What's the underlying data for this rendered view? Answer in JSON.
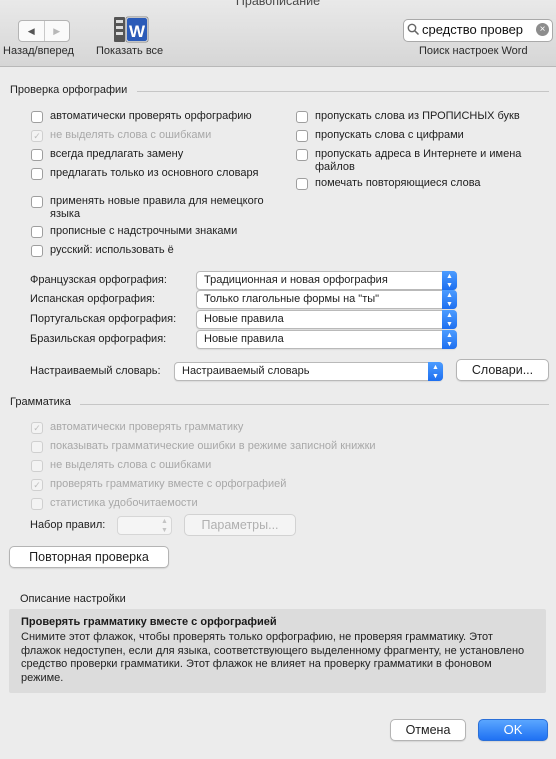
{
  "window": {
    "title": "Правописание"
  },
  "toolbar": {
    "nav_label": "Назад/вперед",
    "show_all_label": "Показать все",
    "search": {
      "value": "средство провер",
      "label": "Поиск настроек Word"
    }
  },
  "spelling": {
    "title": "Проверка орфографии",
    "left_options": [
      {
        "label": "автоматически проверять орфографию",
        "checked": false,
        "disabled": false
      },
      {
        "label": "не выделять слова с ошибками",
        "checked": true,
        "disabled": true
      },
      {
        "label": "всегда предлагать замену",
        "checked": false,
        "disabled": false
      },
      {
        "label": "предлагать только из основного словаря",
        "checked": false,
        "disabled": false
      },
      {
        "label": "применять новые правила для немецкого языка",
        "checked": false,
        "disabled": false
      },
      {
        "label": "прописные с надстрочными знаками",
        "checked": false,
        "disabled": false
      },
      {
        "label": "русский: использовать ё",
        "checked": false,
        "disabled": false
      }
    ],
    "right_options": [
      {
        "label": "пропускать слова из ПРОПИСНЫХ букв",
        "checked": false
      },
      {
        "label": "пропускать слова с цифрами",
        "checked": false
      },
      {
        "label": "пропускать адреса в Интернете и имена файлов",
        "checked": false
      },
      {
        "label": "помечать повторяющиеся слова",
        "checked": false
      }
    ],
    "language_modes": [
      {
        "label": "Французская орфография:",
        "value": "Традиционная и новая орфография"
      },
      {
        "label": "Испанская орфография:",
        "value": "Только глагольные формы на \"ты\""
      },
      {
        "label": "Португальская орфография:",
        "value": "Новые правила"
      },
      {
        "label": "Бразильская орфография:",
        "value": "Новые правила"
      }
    ],
    "custom_dictionary": {
      "label": "Настраиваемый словарь:",
      "value": "Настраиваемый словарь",
      "button": "Словари..."
    }
  },
  "grammar": {
    "title": "Грамматика",
    "options": [
      {
        "label": "автоматически проверять грамматику",
        "checked": true,
        "disabled": true
      },
      {
        "label": "показывать грамматические ошибки в режиме записной книжки",
        "checked": false,
        "disabled": true
      },
      {
        "label": "не выделять слова с ошибками",
        "checked": false,
        "disabled": true
      },
      {
        "label": "проверять грамматику вместе с орфографией",
        "checked": true,
        "disabled": true
      },
      {
        "label": "статистика удобочитаемости",
        "checked": false,
        "disabled": true
      }
    ],
    "rules_label": "Набор правил:",
    "params_button": "Параметры..."
  },
  "recheck_button": "Повторная проверка",
  "description": {
    "title": "Описание настройки",
    "heading": "Проверять грамматику вместе с орфографией",
    "text": "Снимите этот флажок, чтобы проверять только орфографию, не проверяя грамматику. Этот флажок недоступен, если для языка, соответствующего выделенному фрагменту, не установлено средство проверки грамматики. Этот флажок не влияет на проверку грамматики в фоновом режиме."
  },
  "footer": {
    "cancel": "Отмена",
    "ok": "OK"
  },
  "colors": {
    "accent": "#1f71f3",
    "window_bg": "#ececec",
    "disabled_text": "#a8a8a8"
  },
  "icons": {
    "back": "chevron-left-icon",
    "forward": "chevron-right-icon",
    "show_all": "word-grid-icon",
    "search": "magnifier-icon",
    "clear": "clear-circle-icon",
    "popup": "up-down-chevron-icon"
  }
}
